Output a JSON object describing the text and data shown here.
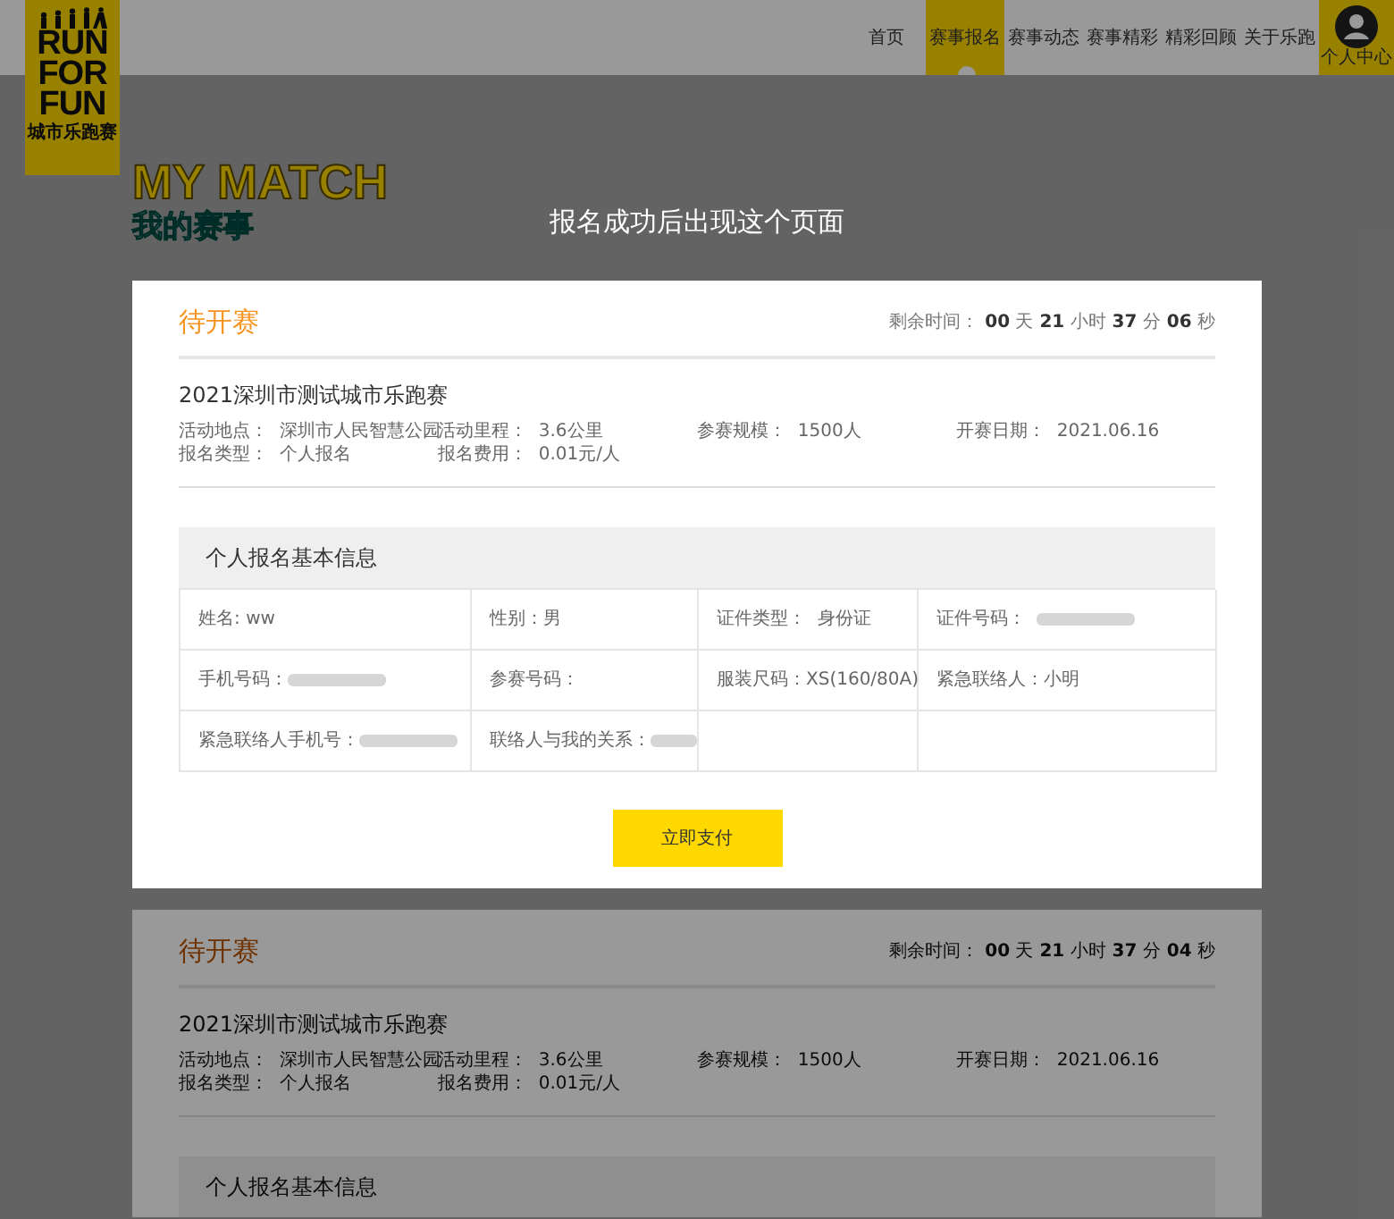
{
  "header": {
    "logo": {
      "lines": [
        "RUN",
        "FOR",
        "FUN"
      ],
      "subtitle": "城市乐跑赛"
    },
    "nav": [
      {
        "label": "首页",
        "selected": false
      },
      {
        "label": "赛事报名",
        "selected": true
      },
      {
        "label": "赛事动态",
        "selected": false
      },
      {
        "label": "赛事精彩",
        "selected": false
      },
      {
        "label": "精彩回顾",
        "selected": false
      },
      {
        "label": "关于乐跑",
        "selected": false
      }
    ],
    "user_button": {
      "label": "个人中心"
    }
  },
  "page_title": {
    "en": "MY MATCH",
    "zh": "我的赛事"
  },
  "background_card": {
    "status": "待开赛",
    "countdown": {
      "label": "剩余时间：",
      "segments": [
        {
          "value": "00",
          "unit": "天"
        },
        {
          "value": "21",
          "unit": "小时"
        },
        {
          "value": "37",
          "unit": "分"
        },
        {
          "value": "04",
          "unit": "秒"
        }
      ]
    },
    "event_name": "2021深圳市测试城市乐跑赛",
    "details": [
      "活动地点：  深圳市人民智慧公园",
      "活动里程：  3.6公里",
      "参赛规模：  1500人",
      "开赛日期：  2021.06.16",
      "报名类型：  个人报名",
      "报名费用：  0.01元/人"
    ],
    "section_title": "个人报名基本信息"
  },
  "overlay": {
    "caption": "报名成功后出现这个页面",
    "modal": {
      "status": "待开赛",
      "countdown": {
        "label": "剩余时间：",
        "segments": [
          {
            "value": "00",
            "unit": "天"
          },
          {
            "value": "21",
            "unit": "小时"
          },
          {
            "value": "37",
            "unit": "分"
          },
          {
            "value": "06",
            "unit": "秒"
          }
        ]
      },
      "event_name": "2021深圳市测试城市乐跑赛",
      "details": [
        "活动地点：  深圳市人民智慧公园",
        "活动里程：  3.6公里",
        "参赛规模：  1500人",
        "开赛日期：  2021.06.16",
        "报名类型：  个人报名",
        "报名费用：  0.01元/人"
      ],
      "section_title": "个人报名基本信息",
      "table": [
        [
          {
            "label": "姓名: ",
            "value": "ww",
            "blurred": false
          },
          {
            "label": "性别：",
            "value": "男",
            "blurred": false
          },
          {
            "label": "证件类型：  ",
            "value": "身份证",
            "blurred": false
          },
          {
            "label": "证件号码：  ",
            "blurred": true
          }
        ],
        [
          {
            "label": "手机号码：",
            "blurred": true
          },
          {
            "label": "参赛号码："
          },
          {
            "label": "服装尺码：",
            "value": "XS(160/80A)",
            "blurred": false
          },
          {
            "label": "紧急联络人：",
            "value": "小明",
            "blurred": false
          }
        ],
        [
          {
            "label": "紧急联络人手机号：",
            "blurred": true
          },
          {
            "label": "联络人与我的关系：",
            "blurred": true
          }
        ]
      ],
      "pay_button": "立即支付"
    }
  }
}
